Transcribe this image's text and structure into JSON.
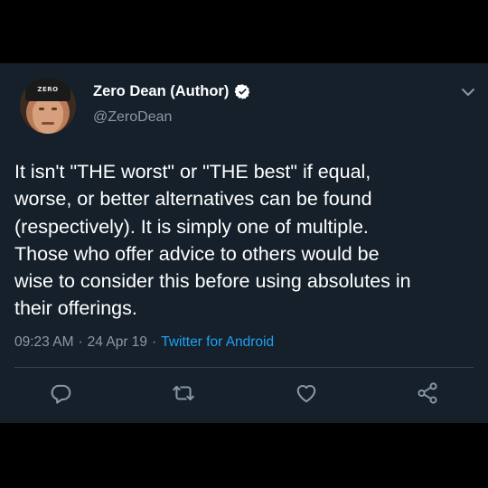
{
  "colors": {
    "background": "#15202b",
    "outer": "#000000",
    "text_primary": "#ffffff",
    "text_secondary": "#8899a6",
    "accent": "#1da1f2"
  },
  "author": {
    "display_name": "Zero Dean (Author)",
    "handle": "@ZeroDean",
    "verified_icon": "verified-badge-icon",
    "avatar_cap_text": "ZERO"
  },
  "tweet": {
    "text": "It isn't \"THE worst\" or \"THE best\" if equal,\nworse, or better alternatives can be found\n(respectively). It is simply one of multiple.\nThose who offer advice to others would be\nwise to consider this before using absolutes in\ntheir offerings.",
    "time": "09:23 AM",
    "separator": "·",
    "date": "24 Apr 19",
    "separator2": "·",
    "source": "Twitter for Android"
  },
  "actions": {
    "reply_icon": "reply-icon",
    "retweet_icon": "retweet-icon",
    "like_icon": "heart-icon",
    "share_icon": "share-icon"
  }
}
